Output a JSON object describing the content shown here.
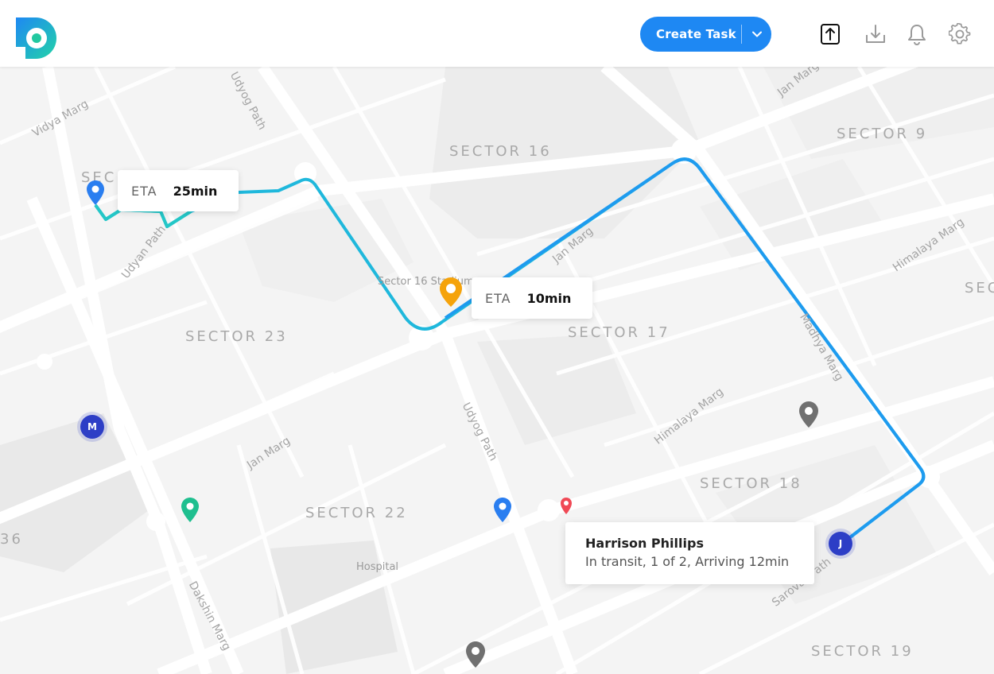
{
  "header": {
    "logo_icon": "app-logo-d",
    "create_task_label": "Create Task",
    "icons": [
      "upload-icon",
      "download-icon",
      "bell-icon",
      "gear-icon"
    ],
    "accent_color": "#1e88f3"
  },
  "map": {
    "areas": [
      "SECTOR 16",
      "SECTOR 9",
      "SECTOR 23",
      "SECTOR 17",
      "SECTOR 18",
      "SECTOR 22",
      "SECTOR 19",
      "SEC",
      "SEC",
      "36"
    ],
    "streets": [
      "Vidya Marg",
      "Udyog Path",
      "Jan Marg",
      "Udyan Path",
      "Jan Marg",
      "Himalaya Marg",
      "Madhya Marg",
      "Himalaya Marg",
      "Udyog Path",
      "Jan Marg",
      "Dakshin Marg",
      "Sarovar Path"
    ],
    "pois": [
      "Sector 16 Stadium",
      "Hospital"
    ],
    "route_colors": {
      "route_a": "#1fc1dc",
      "route_b": "#1e9bef",
      "route_c": "#24c7c7"
    },
    "eta_cards": [
      {
        "label": "ETA",
        "value": "25min"
      },
      {
        "label": "ETA",
        "value": "10min"
      }
    ],
    "driver_card": {
      "name": "Harrison Phillips",
      "status": "In transit, 1 of 2, Arriving 12min"
    },
    "badges": [
      {
        "letter": "M"
      },
      {
        "letter": "J"
      }
    ],
    "pin_colors": {
      "blue": "#2a7ef0",
      "orange": "#f5a30b",
      "green": "#1fbf8f",
      "gray": "#707070",
      "red": "#f04955"
    }
  }
}
